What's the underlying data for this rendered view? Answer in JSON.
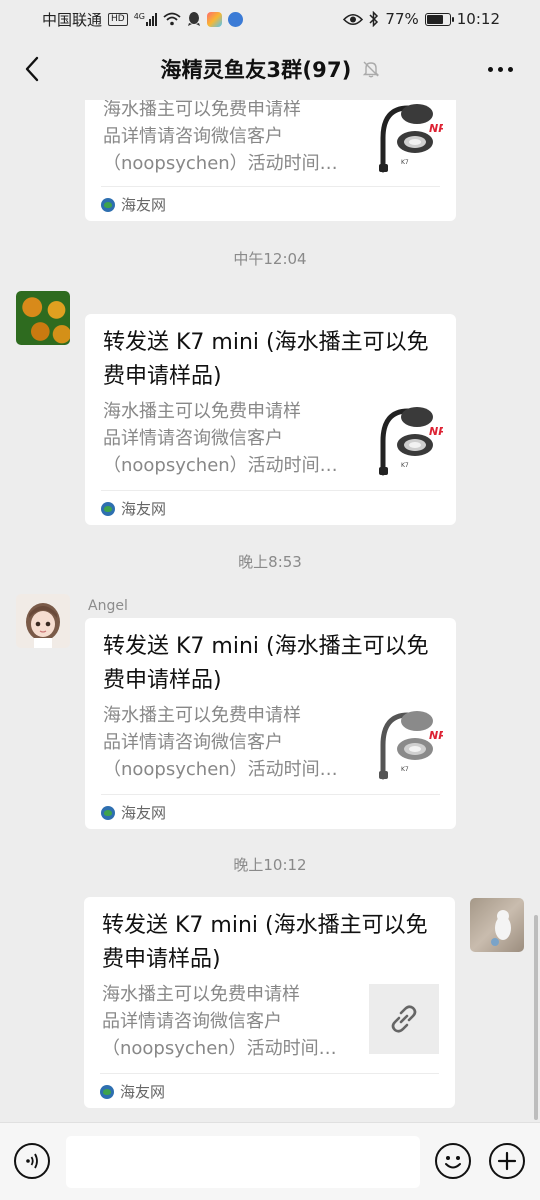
{
  "status_bar": {
    "carrier": "中国联通",
    "hd_badge": "HD",
    "network": "4G",
    "battery": "77%",
    "battery_level": 0.77,
    "time": "10:12"
  },
  "header": {
    "title": "海精灵鱼友3群(97)",
    "back_icon": "chevron-left-icon",
    "mute_icon": "bell-off-icon",
    "more_icon": "more-dots-icon"
  },
  "messages": [
    {
      "type": "link-card",
      "title": "",
      "desc_lines": [
        "海水播主可以免费申请样",
        "品详情请咨询微信客户",
        "（noopsychen）活动时间…"
      ],
      "source": "海友网",
      "thumb": "product-image"
    },
    {
      "type": "timestamp",
      "text": "中午12:04"
    },
    {
      "type": "link-card",
      "sender": "",
      "title": "转发送 K7 mini (海水播主可以免费申请样品)",
      "desc_lines": [
        "海水播主可以免费申请样",
        "品详情请咨询微信客户",
        "（noopsychen）活动时间…"
      ],
      "source": "海友网",
      "thumb": "product-image"
    },
    {
      "type": "timestamp",
      "text": "晚上8:53"
    },
    {
      "type": "link-card",
      "sender": "Angel",
      "title": "转发送 K7 mini (海水播主可以免费申请样品)",
      "desc_lines": [
        "海水播主可以免费申请样",
        "品详情请咨询微信客户",
        "（noopsychen）活动时间…"
      ],
      "source": "海友网",
      "thumb": "product-image"
    },
    {
      "type": "timestamp",
      "text": "晚上10:12"
    },
    {
      "type": "link-card",
      "sender": "",
      "title": "转发送 K7 mini (海水播主可以免费申请样品)",
      "desc_lines": [
        "海水播主可以免费申请样",
        "品详情请咨询微信客户",
        "（noopsychen）活动时间…"
      ],
      "source": "海友网",
      "thumb": "link-icon"
    }
  ],
  "thumb_brand": "NP",
  "thumb_model": "K7",
  "input_bar": {
    "voice_icon": "voice-icon",
    "emoji_icon": "emoji-icon",
    "plus_icon": "plus-icon",
    "placeholder": ""
  }
}
